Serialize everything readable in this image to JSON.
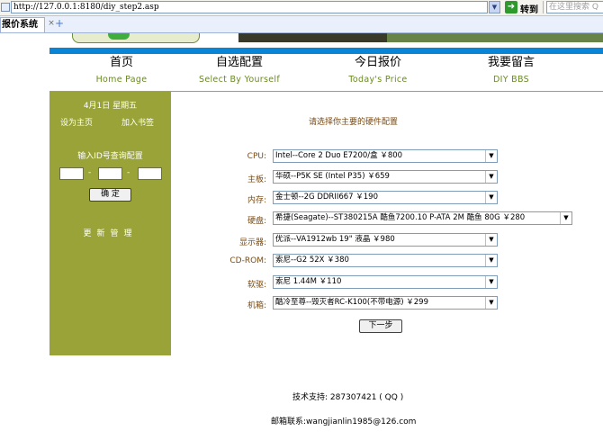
{
  "browser": {
    "address": "http://127.0.0.1:8180/diy_step2.asp",
    "go_label": "转到",
    "search_placeholder": "在这里搜索 Q",
    "tab_title": "报价系统",
    "tab_close": "×",
    "tab_new": "+"
  },
  "nav": [
    {
      "cn": "首页",
      "en": "Home Page"
    },
    {
      "cn": "自选配置",
      "en": "Select By Yourself"
    },
    {
      "cn": "今日报价",
      "en": "Today's Price"
    },
    {
      "cn": "我要留言",
      "en": "DIY BBS"
    }
  ],
  "sidebar": {
    "date": "4月1日 星期五",
    "set_home": "设为主页",
    "add_bookmark": "加入书签",
    "id_query_label": "输入ID号查询配置",
    "dash": "-",
    "confirm": "确 定",
    "update": "更新管理"
  },
  "form": {
    "title": "请选择你主要的硬件配置",
    "rows": [
      {
        "label": "CPU:",
        "value": "Intel--Core 2 Duo E7200/盒      ￥800"
      },
      {
        "label": "主板:",
        "value": "华硕--P5K SE  (Intel P35) ￥659"
      },
      {
        "label": "内存:",
        "value": "金士顿--2G  DDRII667     ￥190"
      },
      {
        "label": "硬盘:",
        "value": "希捷(Seagate)--ST380215A 酷鱼7200.10 P-ATA 2M 酷鱼  80G     ￥280"
      },
      {
        "label": "显示器:",
        "value": "优派--VA1912wb  19\"  液晶  ￥980"
      },
      {
        "label": "CD-ROM:",
        "value": "索尼--G2  52X  ￥380"
      },
      {
        "label": "软驱:",
        "value": "索尼   1.44M  ￥110"
      },
      {
        "label": "机箱:",
        "value": "酷冷至尊--毁灭者RC-K100(不带电源) ￥299"
      }
    ],
    "next_button": "下一步"
  },
  "footer": {
    "support": "技术支持: 287307421 ( QQ )",
    "email": "邮箱联系:wangjianlin1985@126.com"
  },
  "colors": {
    "sidebar_bg": "#99a337",
    "nav_en": "#6a8a22",
    "blue_bar": "#0a84d4",
    "label": "#7a4a10"
  }
}
